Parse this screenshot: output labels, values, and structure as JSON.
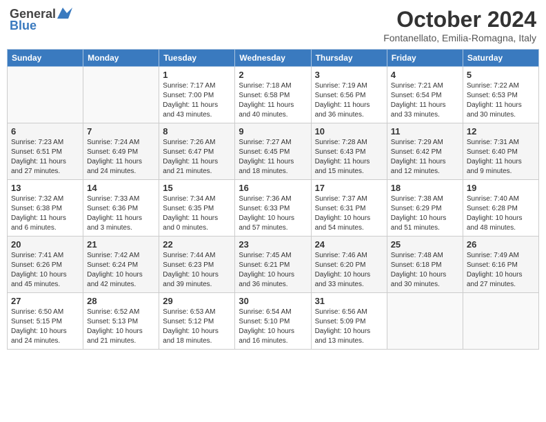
{
  "header": {
    "logo_general": "General",
    "logo_blue": "Blue",
    "month": "October 2024",
    "location": "Fontanellato, Emilia-Romagna, Italy"
  },
  "days_of_week": [
    "Sunday",
    "Monday",
    "Tuesday",
    "Wednesday",
    "Thursday",
    "Friday",
    "Saturday"
  ],
  "weeks": [
    [
      {
        "day": "",
        "sunrise": "",
        "sunset": "",
        "daylight": ""
      },
      {
        "day": "",
        "sunrise": "",
        "sunset": "",
        "daylight": ""
      },
      {
        "day": "1",
        "sunrise": "Sunrise: 7:17 AM",
        "sunset": "Sunset: 7:00 PM",
        "daylight": "Daylight: 11 hours and 43 minutes."
      },
      {
        "day": "2",
        "sunrise": "Sunrise: 7:18 AM",
        "sunset": "Sunset: 6:58 PM",
        "daylight": "Daylight: 11 hours and 40 minutes."
      },
      {
        "day": "3",
        "sunrise": "Sunrise: 7:19 AM",
        "sunset": "Sunset: 6:56 PM",
        "daylight": "Daylight: 11 hours and 36 minutes."
      },
      {
        "day": "4",
        "sunrise": "Sunrise: 7:21 AM",
        "sunset": "Sunset: 6:54 PM",
        "daylight": "Daylight: 11 hours and 33 minutes."
      },
      {
        "day": "5",
        "sunrise": "Sunrise: 7:22 AM",
        "sunset": "Sunset: 6:53 PM",
        "daylight": "Daylight: 11 hours and 30 minutes."
      }
    ],
    [
      {
        "day": "6",
        "sunrise": "Sunrise: 7:23 AM",
        "sunset": "Sunset: 6:51 PM",
        "daylight": "Daylight: 11 hours and 27 minutes."
      },
      {
        "day": "7",
        "sunrise": "Sunrise: 7:24 AM",
        "sunset": "Sunset: 6:49 PM",
        "daylight": "Daylight: 11 hours and 24 minutes."
      },
      {
        "day": "8",
        "sunrise": "Sunrise: 7:26 AM",
        "sunset": "Sunset: 6:47 PM",
        "daylight": "Daylight: 11 hours and 21 minutes."
      },
      {
        "day": "9",
        "sunrise": "Sunrise: 7:27 AM",
        "sunset": "Sunset: 6:45 PM",
        "daylight": "Daylight: 11 hours and 18 minutes."
      },
      {
        "day": "10",
        "sunrise": "Sunrise: 7:28 AM",
        "sunset": "Sunset: 6:43 PM",
        "daylight": "Daylight: 11 hours and 15 minutes."
      },
      {
        "day": "11",
        "sunrise": "Sunrise: 7:29 AM",
        "sunset": "Sunset: 6:42 PM",
        "daylight": "Daylight: 11 hours and 12 minutes."
      },
      {
        "day": "12",
        "sunrise": "Sunrise: 7:31 AM",
        "sunset": "Sunset: 6:40 PM",
        "daylight": "Daylight: 11 hours and 9 minutes."
      }
    ],
    [
      {
        "day": "13",
        "sunrise": "Sunrise: 7:32 AM",
        "sunset": "Sunset: 6:38 PM",
        "daylight": "Daylight: 11 hours and 6 minutes."
      },
      {
        "day": "14",
        "sunrise": "Sunrise: 7:33 AM",
        "sunset": "Sunset: 6:36 PM",
        "daylight": "Daylight: 11 hours and 3 minutes."
      },
      {
        "day": "15",
        "sunrise": "Sunrise: 7:34 AM",
        "sunset": "Sunset: 6:35 PM",
        "daylight": "Daylight: 11 hours and 0 minutes."
      },
      {
        "day": "16",
        "sunrise": "Sunrise: 7:36 AM",
        "sunset": "Sunset: 6:33 PM",
        "daylight": "Daylight: 10 hours and 57 minutes."
      },
      {
        "day": "17",
        "sunrise": "Sunrise: 7:37 AM",
        "sunset": "Sunset: 6:31 PM",
        "daylight": "Daylight: 10 hours and 54 minutes."
      },
      {
        "day": "18",
        "sunrise": "Sunrise: 7:38 AM",
        "sunset": "Sunset: 6:29 PM",
        "daylight": "Daylight: 10 hours and 51 minutes."
      },
      {
        "day": "19",
        "sunrise": "Sunrise: 7:40 AM",
        "sunset": "Sunset: 6:28 PM",
        "daylight": "Daylight: 10 hours and 48 minutes."
      }
    ],
    [
      {
        "day": "20",
        "sunrise": "Sunrise: 7:41 AM",
        "sunset": "Sunset: 6:26 PM",
        "daylight": "Daylight: 10 hours and 45 minutes."
      },
      {
        "day": "21",
        "sunrise": "Sunrise: 7:42 AM",
        "sunset": "Sunset: 6:24 PM",
        "daylight": "Daylight: 10 hours and 42 minutes."
      },
      {
        "day": "22",
        "sunrise": "Sunrise: 7:44 AM",
        "sunset": "Sunset: 6:23 PM",
        "daylight": "Daylight: 10 hours and 39 minutes."
      },
      {
        "day": "23",
        "sunrise": "Sunrise: 7:45 AM",
        "sunset": "Sunset: 6:21 PM",
        "daylight": "Daylight: 10 hours and 36 minutes."
      },
      {
        "day": "24",
        "sunrise": "Sunrise: 7:46 AM",
        "sunset": "Sunset: 6:20 PM",
        "daylight": "Daylight: 10 hours and 33 minutes."
      },
      {
        "day": "25",
        "sunrise": "Sunrise: 7:48 AM",
        "sunset": "Sunset: 6:18 PM",
        "daylight": "Daylight: 10 hours and 30 minutes."
      },
      {
        "day": "26",
        "sunrise": "Sunrise: 7:49 AM",
        "sunset": "Sunset: 6:16 PM",
        "daylight": "Daylight: 10 hours and 27 minutes."
      }
    ],
    [
      {
        "day": "27",
        "sunrise": "Sunrise: 6:50 AM",
        "sunset": "Sunset: 5:15 PM",
        "daylight": "Daylight: 10 hours and 24 minutes."
      },
      {
        "day": "28",
        "sunrise": "Sunrise: 6:52 AM",
        "sunset": "Sunset: 5:13 PM",
        "daylight": "Daylight: 10 hours and 21 minutes."
      },
      {
        "day": "29",
        "sunrise": "Sunrise: 6:53 AM",
        "sunset": "Sunset: 5:12 PM",
        "daylight": "Daylight: 10 hours and 18 minutes."
      },
      {
        "day": "30",
        "sunrise": "Sunrise: 6:54 AM",
        "sunset": "Sunset: 5:10 PM",
        "daylight": "Daylight: 10 hours and 16 minutes."
      },
      {
        "day": "31",
        "sunrise": "Sunrise: 6:56 AM",
        "sunset": "Sunset: 5:09 PM",
        "daylight": "Daylight: 10 hours and 13 minutes."
      },
      {
        "day": "",
        "sunrise": "",
        "sunset": "",
        "daylight": ""
      },
      {
        "day": "",
        "sunrise": "",
        "sunset": "",
        "daylight": ""
      }
    ]
  ]
}
